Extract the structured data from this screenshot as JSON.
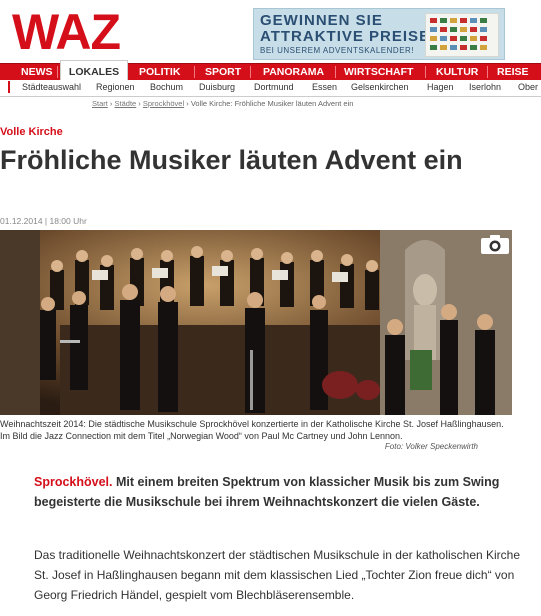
{
  "site": {
    "logo": "WAZ"
  },
  "ad": {
    "line1": "GEWINNEN SIE",
    "line2": "ATTRAKTIVE PREISE",
    "line3": "BEI UNSEREM ADVENTSKALENDER!"
  },
  "nav": {
    "items": [
      "NEWS",
      "LOKALES",
      "POLITIK",
      "SPORT",
      "PANORAMA",
      "WIRTSCHAFT",
      "KULTUR",
      "REISE"
    ],
    "active": "LOKALES"
  },
  "subnav": {
    "items": [
      "Städteauswahl",
      "Regionen",
      "Bochum",
      "Duisburg",
      "Dortmund",
      "Essen",
      "Gelsenkirchen",
      "Hagen",
      "Iserlohn",
      "Ober"
    ]
  },
  "breadcrumb": {
    "items": [
      "Start",
      "Städte",
      "Sprockhövel",
      "Volle Kirche: Fröhliche Musiker läuten Advent ein"
    ]
  },
  "article": {
    "kicker": "Volle Kirche",
    "title": "Fröhliche Musiker läuten Advent ein",
    "date": "01.12.2014",
    "time": "18:00 Uhr",
    "caption": "Weihnachtszeit 2014: Die städtische Musikschule Sprockhövel konzertierte in der Katholische Kirche St. Josef Haßlinghausen. Im Bild die Jazz Connection mit dem Titel „Norwegian Wood“ von Paul Mc Cartney und John Lennon.",
    "credit": "Foto: Volker Speckenwirth",
    "lead_city": "Sprockhövel.",
    "lead_text": "Mit einem breiten Spektrum von klassicher Musik bis zum Swing begeisterte die Musikschule bei ihrem Weihnachtskonzert die vielen Gäste.",
    "paragraph": "Das traditionelle Weihnachtskonzert der städtischen Musikschule in der katholischen Kirche St. Josef in Haßlinghausen begann mit dem klassischen Lied „Tochter Zion freue dich“ von Georg Friedrich Händel, gespielt vom Blechbläserensemble."
  },
  "icons": {
    "camera": "camera-icon"
  },
  "colors": {
    "brand_red": "#d50f1a",
    "ad_blue": "#c7dde8"
  }
}
